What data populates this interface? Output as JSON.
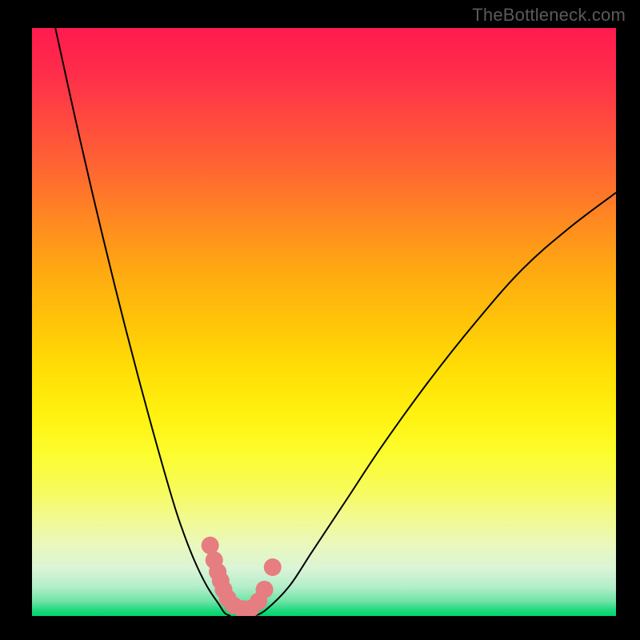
{
  "watermark": "TheBottleneck.com",
  "colors": {
    "background": "#000000",
    "curve": "#000000",
    "marker": "#e67d80",
    "gradient_top": "#ff1a4f",
    "gradient_mid": "#ffde05",
    "gradient_bottom": "#00d36a"
  },
  "chart_data": {
    "type": "line",
    "title": "",
    "xlabel": "",
    "ylabel": "",
    "xlim": [
      0,
      100
    ],
    "ylim": [
      0,
      100
    ],
    "series": [
      {
        "name": "left-curve",
        "x": [
          4,
          8,
          12,
          16,
          20,
          24,
          26,
          28,
          30,
          32,
          33,
          34
        ],
        "values": [
          100,
          82,
          65,
          49,
          34,
          20,
          14,
          9,
          5,
          2,
          0.5,
          0
        ]
      },
      {
        "name": "right-curve",
        "x": [
          38,
          40,
          44,
          48,
          54,
          60,
          68,
          76,
          84,
          92,
          100
        ],
        "values": [
          0,
          1,
          5,
          11,
          20,
          29,
          40,
          50,
          59,
          66,
          72
        ]
      }
    ],
    "markers": [
      {
        "x": 30.5,
        "y": 12
      },
      {
        "x": 31.2,
        "y": 9.5
      },
      {
        "x": 31.8,
        "y": 7.5
      },
      {
        "x": 32.3,
        "y": 6
      },
      {
        "x": 32.8,
        "y": 4.5
      },
      {
        "x": 33.5,
        "y": 3
      },
      {
        "x": 34.5,
        "y": 1.8
      },
      {
        "x": 36,
        "y": 1.2
      },
      {
        "x": 37.5,
        "y": 1.3
      },
      {
        "x": 38.8,
        "y": 2.5
      },
      {
        "x": 39.8,
        "y": 4.5
      },
      {
        "x": 41.2,
        "y": 8.3
      }
    ]
  }
}
